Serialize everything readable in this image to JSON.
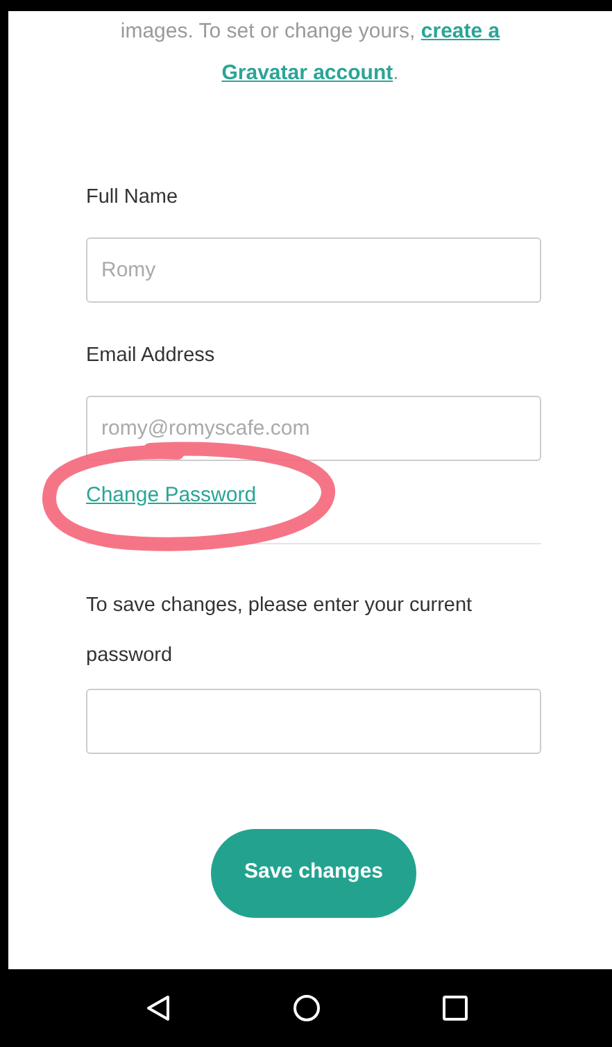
{
  "intro": {
    "text": "images. To set or change yours,",
    "link_1": "create a",
    "link_2": "Gravatar account",
    "end": "."
  },
  "fields": [
    {
      "label": "Full Name",
      "placeholder": "Romy"
    },
    {
      "label": "Email Address",
      "placeholder": "romy@romyscafe.com"
    }
  ],
  "change_password": {
    "label": "Change Password",
    "circled": true
  },
  "confirm": {
    "label": "To save changes, please enter your current password"
  },
  "save_button": "Save changes",
  "nav_bar": {
    "buttons": [
      {
        "kind": "back"
      },
      {
        "kind": "home"
      },
      {
        "kind": "recents"
      }
    ]
  }
}
